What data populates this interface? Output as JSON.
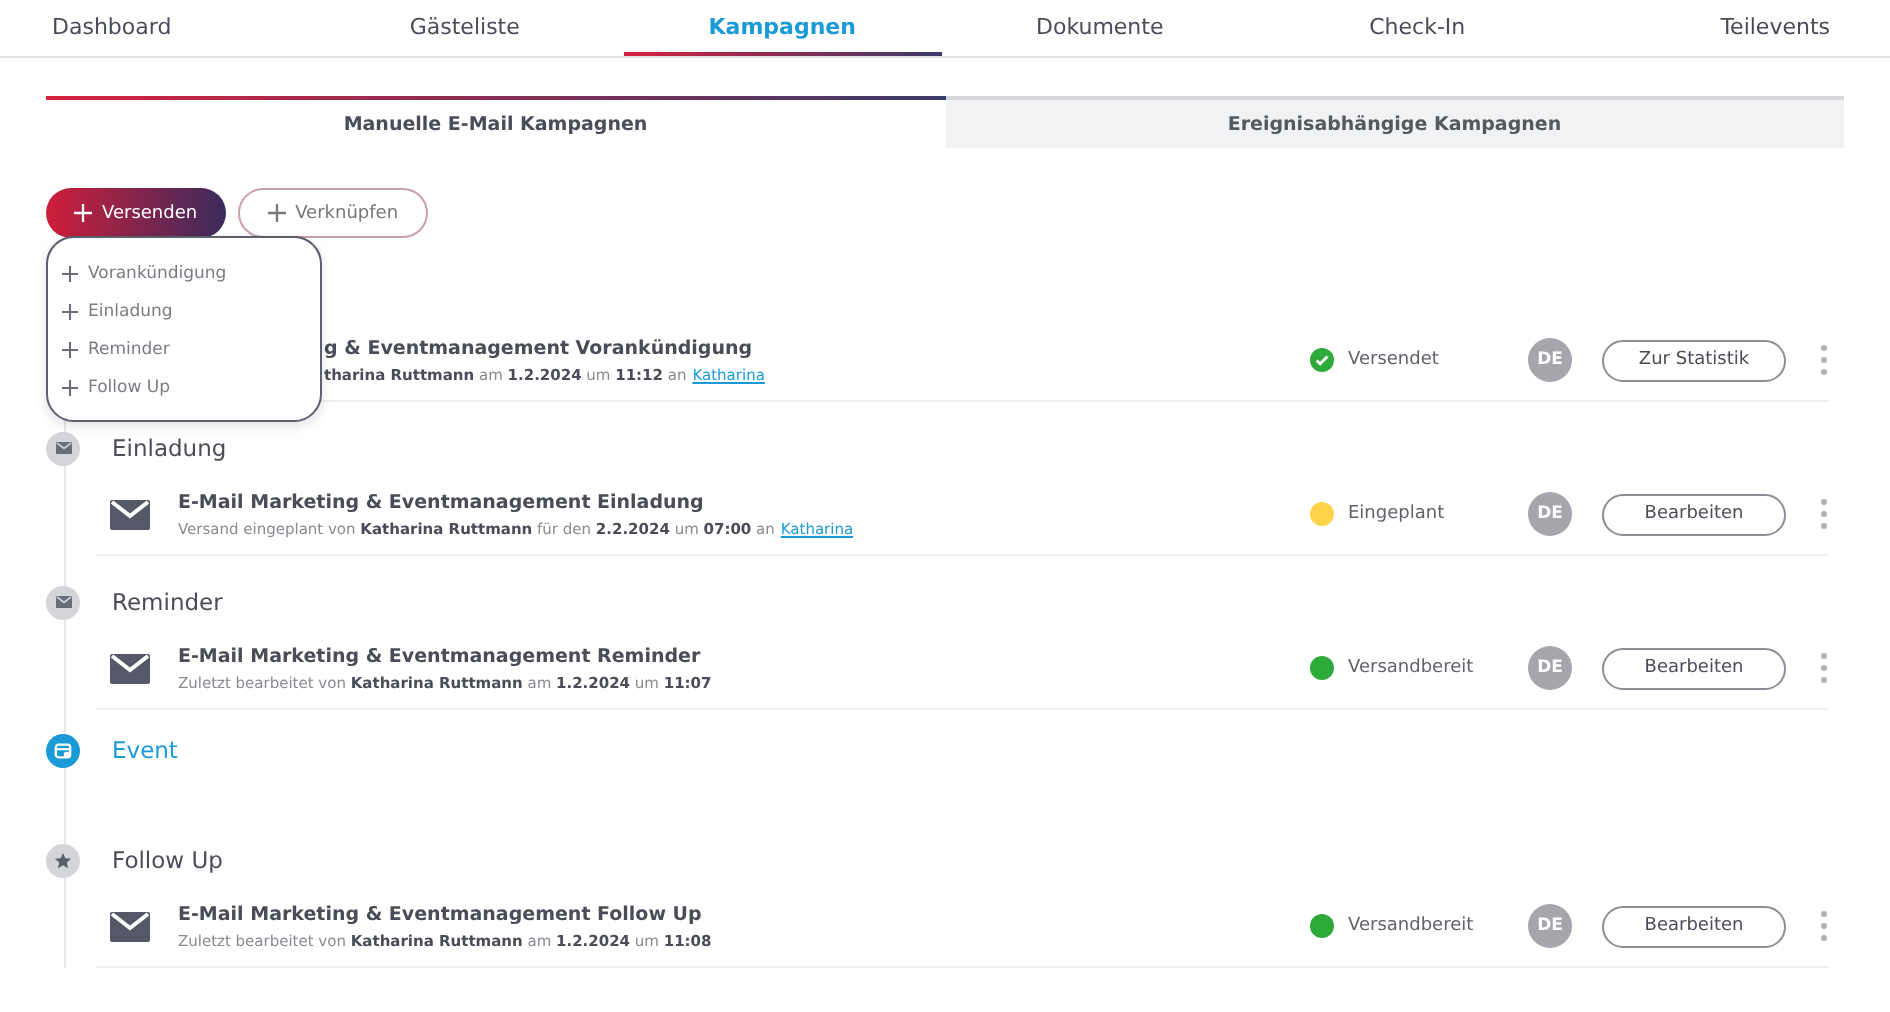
{
  "tabs": [
    {
      "label": "Dashboard",
      "selected": false
    },
    {
      "label": "Gästeliste",
      "selected": false
    },
    {
      "label": "Kampagnen",
      "selected": true
    },
    {
      "label": "Dokumente",
      "selected": false
    },
    {
      "label": "Check-In",
      "selected": false
    },
    {
      "label": "Teilevents",
      "selected": false
    }
  ],
  "subtabs": [
    {
      "label": "Manuelle E-Mail Kampagnen",
      "selected": true
    },
    {
      "label": "Ereignisabhängige Kampagnen",
      "selected": false
    }
  ],
  "actions": [
    {
      "label": "Versenden",
      "kind": "primary"
    },
    {
      "label": "Verknüpfen",
      "kind": "outline"
    }
  ],
  "menu": {
    "items": [
      "Vorankündigung",
      "Einladung",
      "Reminder",
      "Follow Up"
    ]
  },
  "sections": [
    {
      "kind": "covered",
      "rows": [
        {
          "kind": "covered",
          "title": "g & Eventmanagement Vorankündigung",
          "meta": "**tharina Ruttmann** am **1.2.2024** um **11:12** an",
          "link": "Katharina",
          "status": "Versendet",
          "delivered": true,
          "color": "#2eaa3a",
          "lang": "DE",
          "button": "Zur Statistik"
        }
      ]
    },
    {
      "kind": "mail",
      "title": "Einladung",
      "rows": [
        {
          "kind": "mail",
          "title": "E-Mail Marketing & Eventmanagement Einladung",
          "meta": "Versand eingeplant von **Katharina Ruttmann** für den **2.2.2024** um **07:00** an",
          "link": "Katharina",
          "status": "Eingeplant",
          "delivered": false,
          "color": "#fbd44a",
          "lang": "DE",
          "button": "Bearbeiten"
        }
      ]
    },
    {
      "kind": "mail",
      "title": "Reminder",
      "rows": [
        {
          "kind": "mail",
          "title": "E-Mail Marketing & Eventmanagement Reminder",
          "meta": "Zuletzt bearbeitet von **Katharina Ruttmann** am **1.2.2024** um **11:07**",
          "status": "Versandbereit",
          "delivered": false,
          "color": "#2eaa3a",
          "lang": "DE",
          "button": "Bearbeiten"
        }
      ]
    },
    {
      "kind": "event",
      "title": "Event"
    },
    {
      "kind": "star",
      "title": "Follow Up",
      "rows": [
        {
          "kind": "mail",
          "title": "E-Mail Marketing & Eventmanagement Follow Up",
          "meta": "Zuletzt bearbeitet von **Katharina Ruttmann** am **1.2.2024** um **11:08**",
          "status": "Versandbereit",
          "delivered": false,
          "color": "#2eaa3a",
          "lang": "DE",
          "button": "Bearbeiten"
        }
      ]
    }
  ]
}
